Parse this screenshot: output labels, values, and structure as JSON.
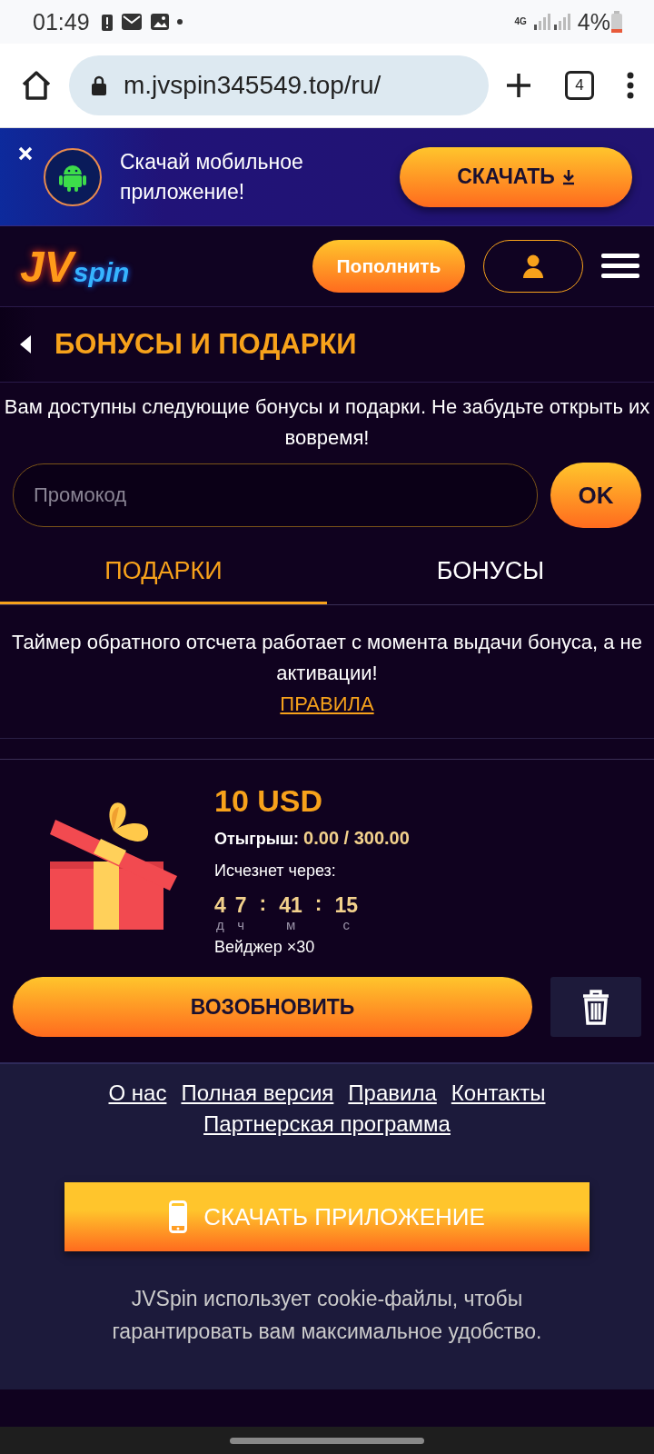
{
  "status_bar": {
    "time": "01:49",
    "network": "4G",
    "battery": "4%"
  },
  "browser": {
    "url": "m.jvspin345549.top/ru/",
    "tab_count": "4"
  },
  "app_banner": {
    "text": "Скачай мобильное приложение!",
    "button": "СКАЧАТЬ"
  },
  "header": {
    "logo": {
      "text_1": "JV",
      "text_2": "spin"
    },
    "deposit_button": "Пополнить"
  },
  "page_title": "БОНУСЫ И ПОДАРКИ",
  "intro": "Вам доступны следующие бонусы и подарки. Не забудьте открыть их вовремя!",
  "promo": {
    "placeholder": "Промокод",
    "button": "OK"
  },
  "tabs": [
    {
      "label": "ПОДАРКИ",
      "selected": true
    },
    {
      "label": "БОНУСЫ",
      "selected": false
    }
  ],
  "notice": "Таймер обратного отсчета работает с момента выдачи бонуса, а не активации!",
  "rules_link": "ПРАВИЛА",
  "gifts": [
    {
      "amount": "10 USD",
      "wager_label": "Отыгрыш:",
      "wager_value": "0.00 / 300.00",
      "expires_label": "Исчезнет через:",
      "countdown": [
        {
          "value": "4",
          "unit": "д"
        },
        {
          "value": "7",
          "unit": "ч"
        },
        {
          "separator": ":",
          "value": "41",
          "unit": "м"
        },
        {
          "separator": ":",
          "value": "15",
          "unit": "с"
        }
      ],
      "wager": "Вейджер ×30",
      "renew_button": "ВОЗОБНОВИТЬ"
    }
  ],
  "footer": {
    "links": [
      "О нас",
      "Полная версия",
      "Правила",
      "Контакты",
      "Партнерская программа"
    ],
    "download_button": "СКАЧАТЬ ПРИЛОЖЕНИЕ",
    "cookie_text": "JVSpin использует cookie-файлы, чтобы гарантировать вам максимальное удобство."
  }
}
